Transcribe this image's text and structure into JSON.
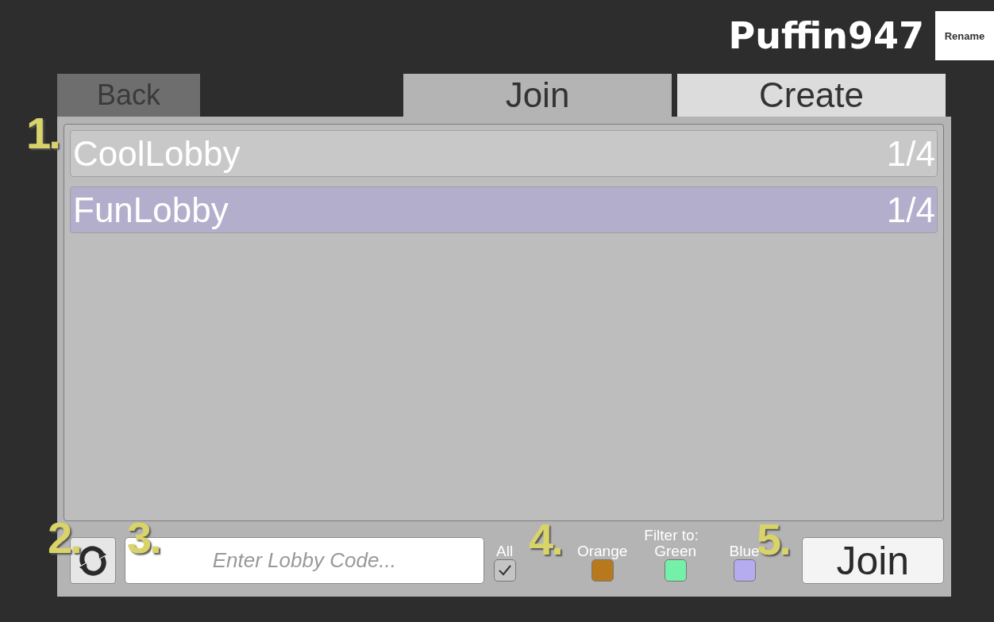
{
  "player": {
    "name": "Puffin947",
    "rename_button": "Rename"
  },
  "back_button": "Back",
  "tabs": [
    {
      "label": "Join",
      "selected": true
    },
    {
      "label": "Create",
      "selected": false
    }
  ],
  "lobbies": [
    {
      "name": "CoolLobby",
      "players": "1/4",
      "selected": false
    },
    {
      "name": "FunLobby",
      "players": "1/4",
      "selected": true
    }
  ],
  "code_field": {
    "placeholder": "Enter Lobby Code..."
  },
  "all_filter": {
    "label": "All",
    "checked": true
  },
  "filter_title": "Filter to:",
  "filters": [
    {
      "label": "Orange",
      "color": "#b8791d",
      "checked": false
    },
    {
      "label": "Green",
      "color": "#74f0a8",
      "checked": false
    },
    {
      "label": "Blue",
      "color": "#b5acf0",
      "checked": false
    }
  ],
  "join_button": "Join",
  "annotations": [
    "1.",
    "2.",
    "3.",
    "4.",
    "5."
  ]
}
